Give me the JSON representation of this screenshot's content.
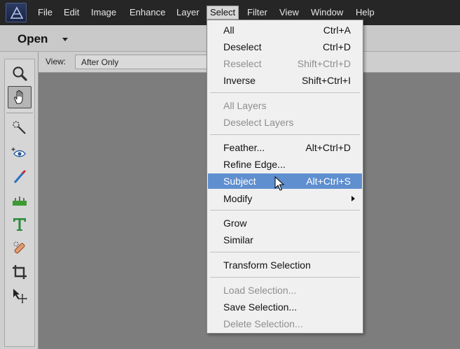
{
  "menubar": {
    "logo_icon": "photoshop-elements-logo-icon",
    "items": [
      "File",
      "Edit",
      "Image",
      "Enhance",
      "Layer",
      "Select",
      "Filter",
      "View",
      "Window",
      "Help"
    ],
    "active_item": "Select"
  },
  "topbar": {
    "open_label": "Open",
    "open_icon": "chevron-down-icon"
  },
  "viewbar": {
    "label": "View:",
    "selected": "After Only"
  },
  "toolbox": {
    "tools": [
      "zoom-tool-icon",
      "hand-tool-icon",
      "quick-selection-tool-icon",
      "eye-tool-icon",
      "whiten-teeth-tool-icon",
      "straighten-tool-icon",
      "type-tool-icon",
      "spot-healing-tool-icon",
      "crop-tool-icon",
      "move-tool-icon"
    ],
    "selected_tool": "hand-tool-icon"
  },
  "select_menu": {
    "items": [
      {
        "label": "All",
        "shortcut": "Ctrl+A",
        "disabled": false
      },
      {
        "label": "Deselect",
        "shortcut": "Ctrl+D",
        "disabled": false
      },
      {
        "label": "Reselect",
        "shortcut": "Shift+Ctrl+D",
        "disabled": true
      },
      {
        "label": "Inverse",
        "shortcut": "Shift+Ctrl+I",
        "disabled": false
      },
      {
        "label": "All Layers",
        "shortcut": "",
        "disabled": true
      },
      {
        "label": "Deselect Layers",
        "shortcut": "",
        "disabled": true
      },
      {
        "label": "Feather...",
        "shortcut": "Alt+Ctrl+D",
        "disabled": false
      },
      {
        "label": "Refine Edge...",
        "shortcut": "",
        "disabled": false
      },
      {
        "label": "Subject",
        "shortcut": "Alt+Ctrl+S",
        "disabled": false,
        "highlighted": true
      },
      {
        "label": "Modify",
        "shortcut": "",
        "disabled": false,
        "submenu": true
      },
      {
        "label": "Grow",
        "shortcut": "",
        "disabled": false
      },
      {
        "label": "Similar",
        "shortcut": "",
        "disabled": false
      },
      {
        "label": "Transform Selection",
        "shortcut": "",
        "disabled": false
      },
      {
        "label": "Load Selection...",
        "shortcut": "",
        "disabled": true
      },
      {
        "label": "Save Selection...",
        "shortcut": "",
        "disabled": false
      },
      {
        "label": "Delete Selection...",
        "shortcut": "",
        "disabled": true
      }
    ],
    "highlight_color": "#5f8fcf",
    "cursor_icon": "mouse-pointer-icon"
  }
}
